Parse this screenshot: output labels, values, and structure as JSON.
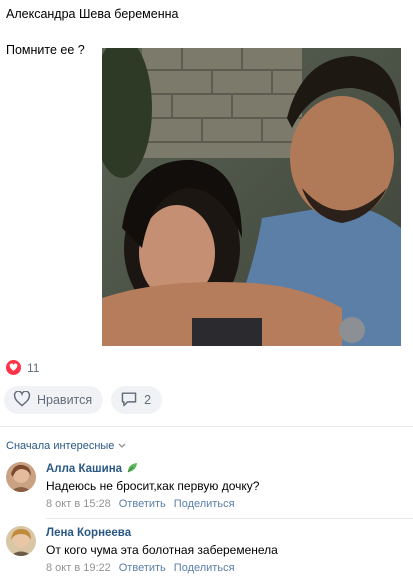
{
  "post": {
    "line1": "Александра Шева беременна",
    "line2": "Помните ее ?"
  },
  "reactions": {
    "count": "11",
    "icon": "heart-icon",
    "color": "#ff3347"
  },
  "actions": {
    "like_label": "Нравится",
    "comments_count": "2"
  },
  "comments_sort": {
    "label": "Сначала интересные"
  },
  "comments": [
    {
      "author": "Алла Кашина",
      "text": "Надеюсь не бросит,как первую дочку?",
      "date": "8 окт в 15:28",
      "reply": "Ответить",
      "share": "Поделиться"
    },
    {
      "author": "Лена Корнеева",
      "text": "От кого чума эта болотная забеременела",
      "date": "8 окт в 19:22",
      "reply": "Ответить",
      "share": "Поделиться"
    }
  ],
  "colors": {
    "link": "#2a5885",
    "muted": "#626d7a",
    "pill_bg": "#f0f2f5"
  }
}
